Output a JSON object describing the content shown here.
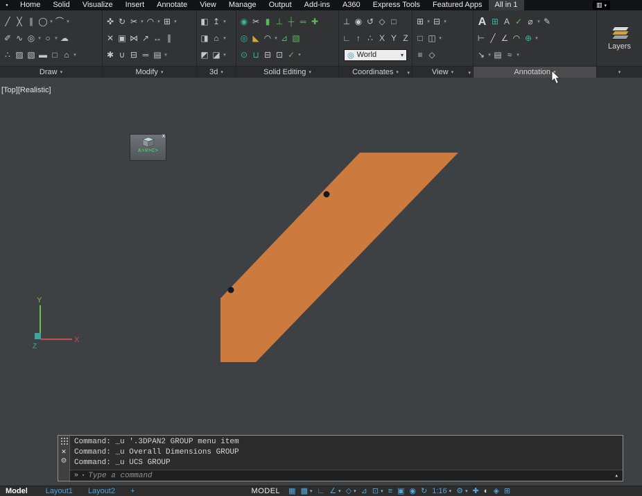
{
  "glyphs": {
    "flyout": "▾",
    "launcher": "▾",
    "close": "✕",
    "gear": "⚙",
    "prompt": "»",
    "caret_up": "▴",
    "cross": "x"
  },
  "colors": {
    "shape_orange": "#cc7a3d",
    "status_blue": "#4fa6da",
    "solid_teal": "#39b3a2",
    "solid_green": "#5cb85a",
    "ucs_x_red": "#c94f4a",
    "ucs_y_green": "#6dbf4e",
    "ucs_z_teal": "#3aa7a0"
  },
  "tab_bar": {
    "app_icon": "▪",
    "toggle_glyph": "▥",
    "toggle_arrow": "▾",
    "tabs": [
      {
        "name": "tab-home",
        "label": "Home"
      },
      {
        "name": "tab-solid",
        "label": "Solid"
      },
      {
        "name": "tab-visualize",
        "label": "Visualize"
      },
      {
        "name": "tab-insert",
        "label": "Insert"
      },
      {
        "name": "tab-annotate",
        "label": "Annotate"
      },
      {
        "name": "tab-view",
        "label": "View"
      },
      {
        "name": "tab-manage",
        "label": "Manage"
      },
      {
        "name": "tab-output",
        "label": "Output"
      },
      {
        "name": "tab-addins",
        "label": "Add-ins"
      },
      {
        "name": "tab-a360",
        "label": "A360"
      },
      {
        "name": "tab-express-tools",
        "label": "Express Tools"
      },
      {
        "name": "tab-featured-apps",
        "label": "Featured Apps"
      },
      {
        "name": "tab-all-in-1",
        "label": "All in 1",
        "cls": "active"
      }
    ]
  },
  "ribbon": {
    "panels": {
      "draw": {
        "label": "Draw",
        "rows": [
          [
            {
              "name": "line-icon",
              "label": "╱"
            },
            {
              "name": "construction-line-icon",
              "label": "╳"
            },
            {
              "name": "multiline-icon",
              "label": "∥"
            },
            {
              "name": "circle-icon",
              "label": "◯"
            },
            {
              "name": "circle-flyout-arrow",
              "label": "▾",
              "cls": "dd"
            },
            {
              "name": "arc-icon",
              "label": "⌒"
            },
            {
              "name": "arc-flyout-arrow",
              "label": "▾",
              "cls": "dd"
            }
          ],
          [
            {
              "name": "polyline-icon",
              "label": "✐"
            },
            {
              "name": "spline-icon",
              "label": "∿"
            },
            {
              "name": "donut-icon",
              "label": "◎"
            },
            {
              "name": "donut-flyout-arrow",
              "label": "▾",
              "cls": "dd"
            },
            {
              "name": "ellipse-icon",
              "label": "○"
            },
            {
              "name": "ellipse-flyout-arrow",
              "label": "▾",
              "cls": "dd"
            },
            {
              "name": "revision-cloud-icon",
              "label": "☁"
            }
          ],
          [
            {
              "name": "point-icon",
              "label": "∴"
            },
            {
              "name": "hatch-icon",
              "label": "▨"
            },
            {
              "name": "gradient-icon",
              "label": "▧"
            },
            {
              "name": "region-icon",
              "label": "▬"
            },
            {
              "name": "boundary-icon",
              "label": "□"
            },
            {
              "name": "polygon-icon",
              "label": "⌂"
            },
            {
              "name": "draw-more-arrow",
              "label": "▾",
              "cls": "dd"
            }
          ]
        ]
      },
      "modify": {
        "label": "Modify",
        "rows": [
          [
            {
              "name": "move-icon",
              "label": "✜"
            },
            {
              "name": "rotate-icon",
              "label": "↻"
            },
            {
              "name": "trim-icon",
              "label": "✂"
            },
            {
              "name": "trim-flyout-arrow",
              "label": "▾",
              "cls": "dd"
            },
            {
              "name": "fillet-icon",
              "label": "◠"
            },
            {
              "name": "fillet-flyout-arrow",
              "label": "▾",
              "cls": "dd"
            },
            {
              "name": "array-icon",
              "label": "⊞"
            },
            {
              "name": "array-flyout-arrow",
              "label": "▾",
              "cls": "dd"
            }
          ],
          [
            {
              "name": "erase-icon",
              "label": "✕"
            },
            {
              "name": "copy-icon",
              "label": "▣"
            },
            {
              "name": "mirror-icon",
              "label": "⋈"
            },
            {
              "name": "scale-icon",
              "label": "↗"
            },
            {
              "name": "stretch-icon",
              "label": "↔"
            },
            {
              "name": "offset-icon",
              "label": "∥"
            }
          ],
          [
            {
              "name": "explode-icon",
              "label": "✱"
            },
            {
              "name": "join-icon",
              "label": "∪"
            },
            {
              "name": "break-icon",
              "label": "⊟"
            },
            {
              "name": "lengthen-icon",
              "label": "═"
            },
            {
              "name": "edit-polyline-icon",
              "label": "▤"
            },
            {
              "name": "modify-more-arrow",
              "label": "▾",
              "cls": "dd"
            }
          ]
        ]
      },
      "modeling3d": {
        "label": "3d",
        "rows": [
          [
            {
              "name": "box-icon",
              "label": "◧"
            },
            {
              "name": "extrude-icon",
              "label": "↥"
            },
            {
              "name": "box-flyout-arrow",
              "label": "▾",
              "cls": "dd"
            }
          ],
          [
            {
              "name": "presspull-icon",
              "label": "◨"
            },
            {
              "name": "polysolid-icon",
              "label": "⌂"
            },
            {
              "name": "presspull-flyout-arrow",
              "label": "▾",
              "cls": "dd"
            }
          ],
          [
            {
              "name": "sweep-icon",
              "label": "◩"
            },
            {
              "name": "loft-icon",
              "label": "◪"
            },
            {
              "name": "sweep-flyout-arrow",
              "label": "▾",
              "cls": "dd"
            }
          ]
        ]
      },
      "solid_editing": {
        "label": "Solid Editing",
        "rows": [
          [
            {
              "name": "union-icon",
              "label": "◉",
              "cls": "teal"
            },
            {
              "name": "slice-icon",
              "label": "✂"
            },
            {
              "name": "thicken-icon",
              "label": "▮",
              "cls": "grn"
            },
            {
              "name": "imprint-icon",
              "label": "⊥",
              "cls": "grn"
            },
            {
              "name": "interfere-icon",
              "label": "┼",
              "cls": "grn"
            },
            {
              "name": "extract-edges-icon",
              "label": "═",
              "cls": "grn"
            },
            {
              "name": "offset-edge-icon",
              "label": "✚",
              "cls": "grn"
            }
          ],
          [
            {
              "name": "subtract-icon",
              "label": "◎",
              "cls": "teal"
            },
            {
              "name": "chamfer-edge-icon",
              "label": "◣",
              "cls": "ylw"
            },
            {
              "name": "fillet-edge-icon",
              "label": "◠"
            },
            {
              "name": "fillet-edge-arrow",
              "label": "▾",
              "cls": "dd"
            },
            {
              "name": "taper-faces-icon",
              "label": "⊿",
              "cls": "grn"
            },
            {
              "name": "extrude-faces-icon",
              "label": "▧",
              "cls": "grn"
            }
          ],
          [
            {
              "name": "intersect-icon",
              "label": "⊙",
              "cls": "teal"
            },
            {
              "name": "shell-icon",
              "label": "⊔",
              "cls": "teal"
            },
            {
              "name": "separate-icon",
              "label": "⊟"
            },
            {
              "name": "clean-icon",
              "label": "⊡"
            },
            {
              "name": "check-icon",
              "label": "✓",
              "cls": "grn"
            },
            {
              "name": "solid-more-arrow",
              "label": "▾",
              "cls": "dd"
            }
          ]
        ]
      },
      "coordinates": {
        "label": "Coordinates",
        "launcher": "▾",
        "combo": {
          "globe": "◎",
          "value": "World",
          "arrow": "▾"
        },
        "rows": [
          [
            {
              "name": "ucs-icon",
              "label": "⊥"
            },
            {
              "name": "ucs-world-icon",
              "label": "◉"
            },
            {
              "name": "ucs-previous-icon",
              "label": "↺"
            },
            {
              "name": "ucs-face-icon",
              "label": "◇"
            },
            {
              "name": "ucs-object-icon",
              "label": "□"
            }
          ],
          [
            {
              "name": "ucs-origin-icon",
              "label": "∟"
            },
            {
              "name": "ucs-zaxis-icon",
              "label": "↑"
            },
            {
              "name": "ucs-3point-icon",
              "label": "∴"
            },
            {
              "name": "ucs-x-icon",
              "label": "X"
            },
            {
              "name": "ucs-y-icon",
              "label": "Y"
            },
            {
              "name": "ucs-z-icon",
              "label": "Z"
            }
          ]
        ]
      },
      "view": {
        "label": "View",
        "launcher": "▾",
        "rows": [
          [
            {
              "name": "named-views-icon",
              "label": "⊞"
            },
            {
              "name": "named-views-arrow",
              "label": "▾",
              "cls": "dd"
            },
            {
              "name": "viewport-config-icon",
              "label": "⊟"
            },
            {
              "name": "viewport-config-arrow",
              "label": "▾",
              "cls": "dd"
            }
          ],
          [
            {
              "name": "view-restore-icon",
              "label": "□"
            },
            {
              "name": "view-join-icon",
              "label": "◫"
            },
            {
              "name": "view-flyout-arrow",
              "label": "▾",
              "cls": "dd"
            }
          ],
          [
            {
              "name": "navigation-bar-icon",
              "label": "≡"
            },
            {
              "name": "viewcube-toggle-icon",
              "label": "◇"
            }
          ]
        ]
      },
      "annotation": {
        "label": "Annotation",
        "rows": [
          [
            {
              "name": "text-icon",
              "label": "A",
              "cls": "big-a"
            },
            {
              "name": "table-icon",
              "label": "⊞",
              "cls": "teal"
            },
            {
              "name": "text-style-icon",
              "label": "A"
            },
            {
              "name": "spell-check-icon",
              "label": "✓",
              "cls": "grn"
            },
            {
              "name": "dimension-icon",
              "label": "⌀"
            },
            {
              "name": "dimension-flyout-arrow",
              "label": "▾",
              "cls": "dd"
            },
            {
              "name": "dim-style-icon",
              "label": "✎"
            }
          ],
          [
            {
              "name": "linear-dimension-icon",
              "label": "⊢"
            },
            {
              "name": "aligned-dimension-icon",
              "label": "╱"
            },
            {
              "name": "angular-dimension-icon",
              "label": "∠"
            },
            {
              "name": "radius-dimension-icon",
              "label": "◠"
            },
            {
              "name": "center-mark-icon",
              "label": "⊕",
              "cls": "teal"
            },
            {
              "name": "dim-more-arrow",
              "label": "▾",
              "cls": "dd"
            }
          ],
          [
            {
              "name": "multileader-icon",
              "label": "↘"
            },
            {
              "name": "leader-style-arrow",
              "label": "▾",
              "cls": "dd"
            },
            {
              "name": "annotation-table-icon",
              "label": "▤"
            },
            {
              "name": "match-annotation-icon",
              "label": "≈"
            },
            {
              "name": "annotation-more-arrow",
              "label": "▾",
              "cls": "dd"
            }
          ]
        ]
      },
      "layers": {
        "label": "Layers"
      }
    }
  },
  "canvas": {
    "viewport_controls": "[Top][Realistic]",
    "shape_fill": "#cc7a3d",
    "avc": {
      "text": "A>V>C>",
      "close": "x"
    },
    "ucs": {
      "x": "X",
      "y": "Y",
      "z": "Z"
    }
  },
  "command": {
    "history": [
      "Command: _u '.3DPAN2 GROUP menu item",
      "Command: _u Overall Dimensions GROUP",
      "Command: _u UCS GROUP"
    ],
    "placeholder": "Type a command"
  },
  "statusbar": {
    "model_tab": "Model",
    "layouts": [
      {
        "name": "layout1-tab",
        "label": "Layout1"
      },
      {
        "name": "layout2-tab",
        "label": "Layout2"
      },
      {
        "name": "new-layout-button",
        "label": "+"
      }
    ],
    "space_label": "MODEL",
    "annotation_scale": "1:16",
    "icons": [
      {
        "name": "grid-display-icon",
        "label": "▦"
      },
      {
        "name": "snap-mode-icon",
        "label": "▩"
      },
      {
        "name": "snap-mode-arrow",
        "label": "▾",
        "cls": "dd"
      },
      {
        "name": "ortho-mode-icon",
        "label": "∟"
      },
      {
        "name": "polar-tracking-icon",
        "label": "∠"
      },
      {
        "name": "polar-tracking-arrow",
        "label": "▾",
        "cls": "dd"
      },
      {
        "name": "isometric-drafting-icon",
        "label": "◇"
      },
      {
        "name": "isometric-drafting-arrow",
        "label": "▾",
        "cls": "dd"
      },
      {
        "name": "object-snap-tracking-icon",
        "label": "⊿"
      },
      {
        "name": "object-snap-icon",
        "label": "⊡"
      },
      {
        "name": "object-snap-arrow",
        "label": "▾",
        "cls": "dd"
      },
      {
        "name": "lineweight-icon",
        "label": "≡"
      },
      {
        "name": "selection-cycling-icon",
        "label": "▣"
      },
      {
        "name": "annotation-visibility-icon",
        "label": "◉"
      },
      {
        "name": "autoscale-icon",
        "label": "↻"
      },
      {
        "name": "annotation-scale-button",
        "label": "1:16"
      },
      {
        "name": "annotation-scale-arrow",
        "label": "▾",
        "cls": "dd"
      },
      {
        "name": "workspace-switching-icon",
        "label": "⚙"
      },
      {
        "name": "workspace-switching-arrow",
        "label": "▾",
        "cls": "dd"
      },
      {
        "name": "annotation-monitor-icon",
        "label": "✚"
      },
      {
        "name": "isolate-objects-icon",
        "label": "◐",
        "cls": "lt"
      },
      {
        "name": "graphics-performance-icon",
        "label": "◈"
      },
      {
        "name": "clean-screen-icon",
        "label": "⊞"
      }
    ]
  }
}
